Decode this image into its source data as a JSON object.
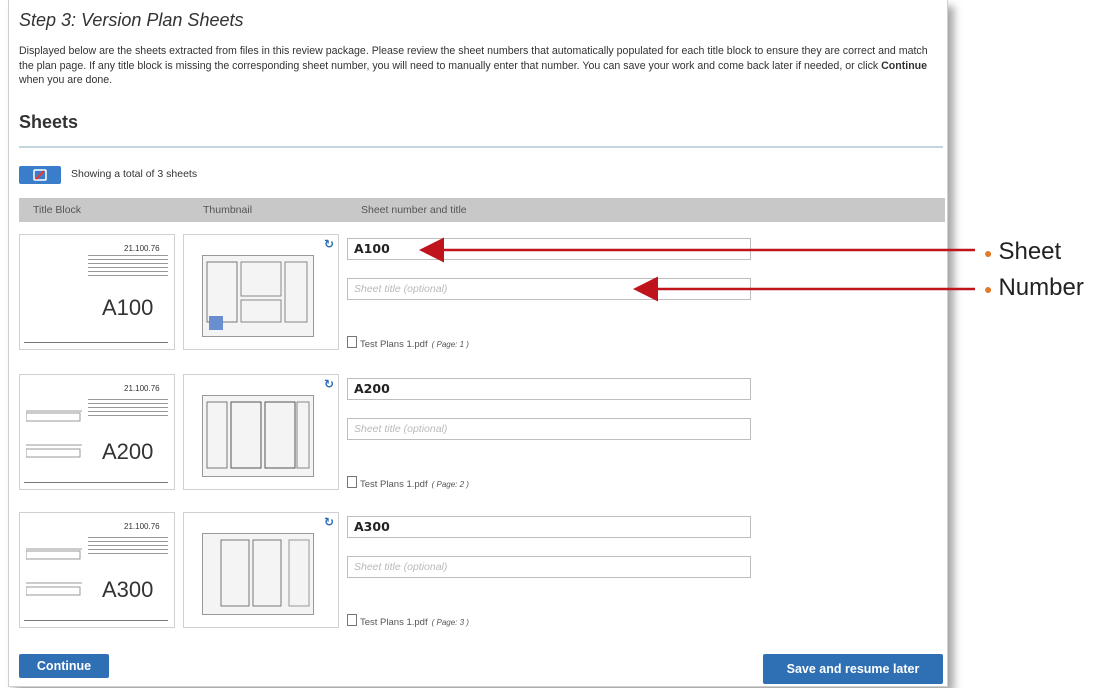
{
  "step_title": "Step 3: Version Plan Sheets",
  "intro": {
    "text_before": "Displayed below are the sheets extracted from files in this review package. Please review the sheet numbers that automatically populated for each title block to ensure they are correct and match the plan page. If any title block is missing the corresponding sheet number, you will need to manually enter that number. You can save your work and come back later if needed, or click ",
    "bold": "Continue",
    "text_after": " when you are done."
  },
  "sheets_heading": "Sheets",
  "showing_text": "Showing a total of 3 sheets",
  "columns": [
    "Title Block",
    "Thumbnail",
    "Sheet number and title"
  ],
  "sheets": [
    {
      "code": "A100",
      "project_no": "21.100.76",
      "sheet_number": "A100",
      "title_placeholder": "Sheet title (optional)",
      "file": "Test Plans 1.pdf",
      "page": "( Page: 1 )"
    },
    {
      "code": "A200",
      "project_no": "21.100.76",
      "sheet_number": "A200",
      "title_placeholder": "Sheet title (optional)",
      "file": "Test Plans 1.pdf",
      "page": "( Page: 2 )"
    },
    {
      "code": "A300",
      "project_no": "21.100.76",
      "sheet_number": "A300",
      "title_placeholder": "Sheet title (optional)",
      "file": "Test Plans 1.pdf",
      "page": "( Page: 3 )"
    }
  ],
  "buttons": {
    "continue": "Continue",
    "save": "Save and resume later"
  },
  "legend": [
    "Sheet",
    "Number"
  ],
  "colors": {
    "accent": "#2f6fb3",
    "arrow": "#c0141c",
    "bullet": "#e07b2e"
  },
  "icons": {
    "refresh": "refresh-icon",
    "pdf": "pdf-file-icon",
    "toggle": "toggle-icon"
  }
}
